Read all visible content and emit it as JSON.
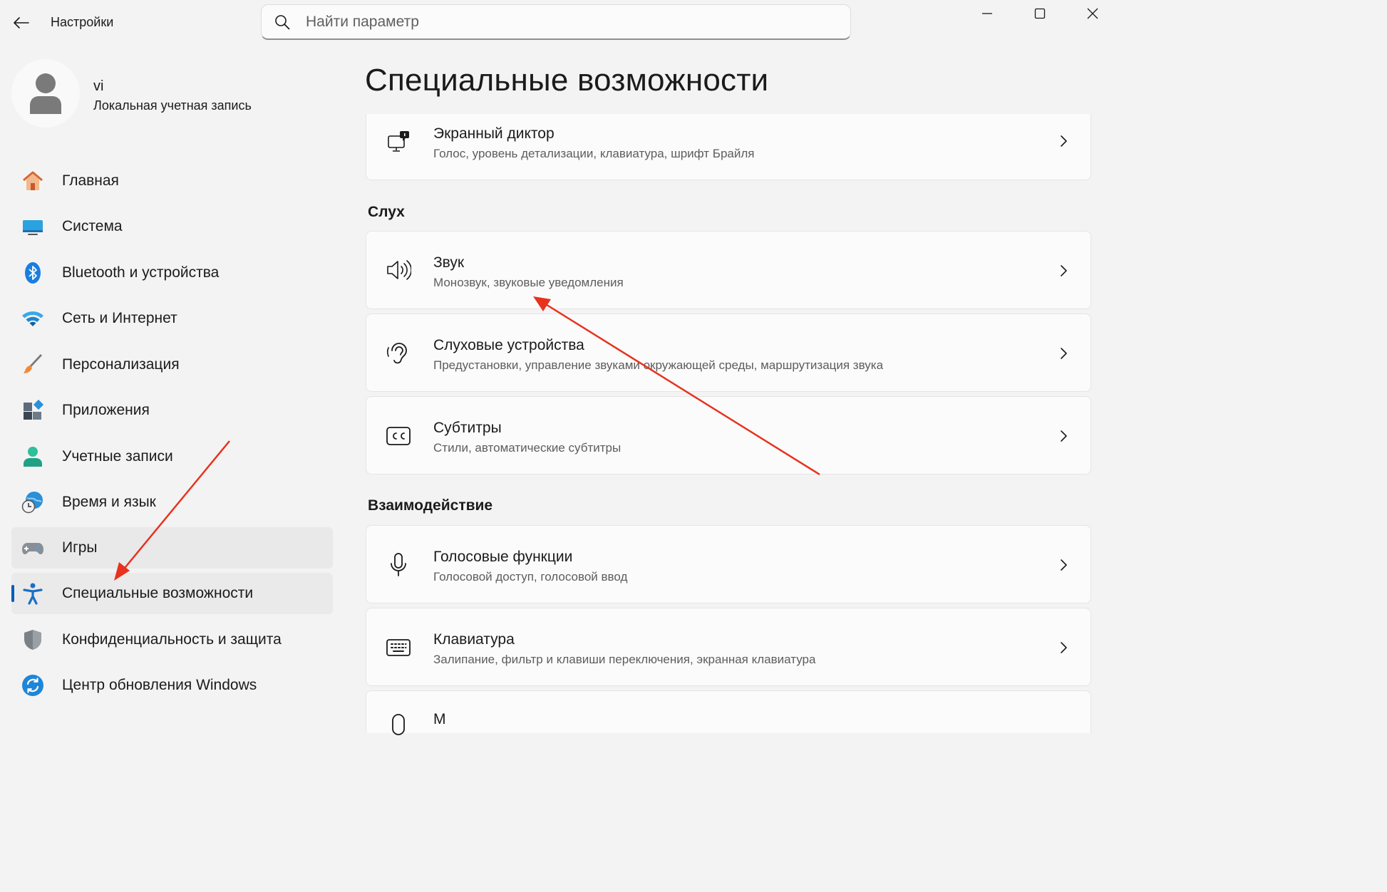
{
  "window": {
    "app_title": "Настройки",
    "search_placeholder": "Найти параметр"
  },
  "profile": {
    "name": "vi",
    "account_type": "Локальная учетная запись"
  },
  "sidebar": {
    "items": [
      {
        "label": "Главная",
        "icon": "home-icon"
      },
      {
        "label": "Система",
        "icon": "system-icon"
      },
      {
        "label": "Bluetooth и устройства",
        "icon": "bluetooth-icon"
      },
      {
        "label": "Сеть и Интернет",
        "icon": "wifi-icon"
      },
      {
        "label": "Персонализация",
        "icon": "brush-icon"
      },
      {
        "label": "Приложения",
        "icon": "apps-icon"
      },
      {
        "label": "Учетные записи",
        "icon": "account-icon"
      },
      {
        "label": "Время и язык",
        "icon": "time-language-icon"
      },
      {
        "label": "Игры",
        "icon": "gamepad-icon"
      },
      {
        "label": "Специальные возможности",
        "icon": "accessibility-icon"
      },
      {
        "label": "Конфиденциальность и защита",
        "icon": "shield-icon"
      },
      {
        "label": "Центр обновления Windows",
        "icon": "update-icon"
      }
    ],
    "active_index": 9,
    "hover_index": 8
  },
  "main": {
    "title": "Специальные возможности",
    "narrator": {
      "title": "Экранный диктор",
      "subtitle": "Голос, уровень детализации, клавиатура, шрифт Брайля",
      "icon": "narrator-icon"
    },
    "sections": [
      {
        "header": "Слух",
        "items": [
          {
            "title": "Звук",
            "subtitle": "Монозвук, звуковые уведомления",
            "icon": "speaker-icon"
          },
          {
            "title": "Слуховые устройства",
            "subtitle": "Предустановки, управление звуками окружающей среды, маршрутизация звука",
            "icon": "ear-icon"
          },
          {
            "title": "Субтитры",
            "subtitle": "Стили, автоматические субтитры",
            "icon": "captions-icon"
          }
        ]
      },
      {
        "header": "Взаимодействие",
        "items": [
          {
            "title": "Голосовые функции",
            "subtitle": "Голосовой доступ, голосовой ввод",
            "icon": "microphone-icon"
          },
          {
            "title": "Клавиатура",
            "subtitle": "Залипание, фильтр и клавиши переключения, экранная клавиатура",
            "icon": "keyboard-icon"
          },
          {
            "title": "М",
            "subtitle": "",
            "icon": "mouse-icon"
          }
        ]
      }
    ]
  },
  "colors": {
    "accent": "#005fb8",
    "annotation_arrow": "#e8321e",
    "background": "#f3f3f3",
    "card": "#fbfbfb"
  }
}
